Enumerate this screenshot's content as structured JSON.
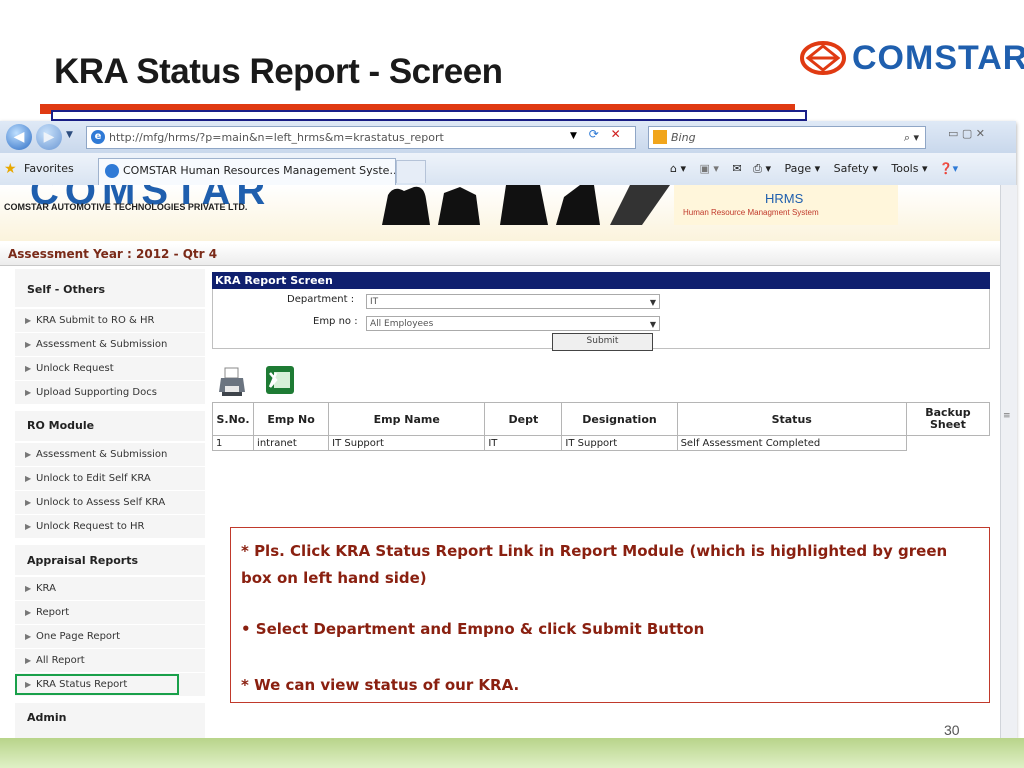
{
  "slide": {
    "title": "KRA Status Report - Screen",
    "brand_name": "COMSTAR",
    "page_number": "30",
    "colors": {
      "title_bar_red": "#e03a12",
      "title_bar_blue": "#1a1f8a",
      "brand_blue": "#1f5fae",
      "note_text": "#8a2010"
    }
  },
  "browser": {
    "url": "http://mfg/hrms/?p=main&n=left_hrms&m=krastatus_report",
    "search_engine": "Bing",
    "favorites_label": "Favorites",
    "tab_title": "COMSTAR Human Resources Management Syste...",
    "command_bar": {
      "page": "Page ▾",
      "safety": "Safety ▾",
      "tools": "Tools ▾"
    },
    "window_controls": "▭ ▢ ✕"
  },
  "site": {
    "logo_text": "COMSTAR",
    "company_name": "COMSTAR AUTOMOTIVE TECHNOLOGIES PRIVATE LTD.",
    "hrms_logo": "HRMS",
    "hrms_tagline": "Human Resource Managment System",
    "assessment_year": "Assessment Year : 2012 - Qtr 4"
  },
  "sidebar": {
    "sections": [
      {
        "heading": "Self - Others",
        "items": [
          "KRA Submit to RO & HR",
          "Assessment & Submission",
          "Unlock Request",
          "Upload Supporting Docs"
        ]
      },
      {
        "heading": "RO Module",
        "items": [
          "Assessment & Submission",
          "Unlock to Edit Self KRA",
          "Unlock to Assess Self KRA",
          "Unlock Request to HR"
        ]
      },
      {
        "heading": "Appraisal Reports",
        "items": [
          "KRA",
          "Report",
          "One Page Report",
          "All Report",
          "KRA Status Report"
        ]
      },
      {
        "heading": "Admin",
        "items": []
      }
    ],
    "highlighted_item": "KRA Status Report",
    "highlight_color": "#19a04a"
  },
  "report": {
    "header": "KRA Report Screen",
    "department_label": "Department :",
    "department_value": "IT",
    "empno_label": "Emp no :",
    "empno_value": "All Employees",
    "submit_label": "Submit",
    "columns": [
      "S.No.",
      "Emp No",
      "Emp Name",
      "Dept",
      "Designation",
      "Status",
      "Backup Sheet"
    ],
    "rows": [
      [
        "1",
        "intranet",
        "IT Support",
        "IT",
        "IT Support",
        "Self Assessment Completed",
        ""
      ]
    ]
  },
  "note": {
    "line1": "* Pls. Click KRA Status Report Link in Report Module (which is highlighted by green box on left hand side)",
    "line2": "• Select Department and Empno & click Submit Button",
    "line3": "* We can view status of our KRA."
  }
}
